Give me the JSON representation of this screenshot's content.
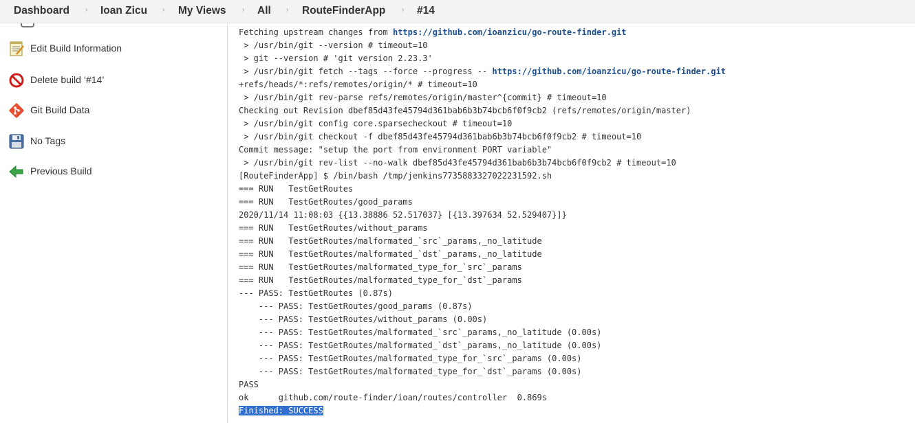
{
  "breadcrumb": {
    "items": [
      "Dashboard",
      "Ioan Zicu",
      "My Views",
      "All",
      "RouteFinderApp",
      "#14"
    ],
    "separator": "›"
  },
  "sidebar": {
    "items": [
      {
        "label": "Edit Build Information",
        "icon": "notepad-icon"
      },
      {
        "label": "Delete build ‘#14’",
        "icon": "no-entry-icon"
      },
      {
        "label": "Git Build Data",
        "icon": "git-icon"
      },
      {
        "label": "No Tags",
        "icon": "floppy-disk-icon"
      },
      {
        "label": "Previous Build",
        "icon": "left-arrow-icon"
      }
    ]
  },
  "console": {
    "lines": [
      {
        "pre": "Fetching upstream changes from ",
        "link": "https://github.com/ioanzicu/go-route-finder.git",
        "post": ""
      },
      {
        "text": " > /usr/bin/git --version # timeout=10"
      },
      {
        "text": " > git --version # 'git version 2.23.3'"
      },
      {
        "pre": " > /usr/bin/git fetch --tags --force --progress -- ",
        "link": "https://github.com/ioanzicu/go-route-finder.git",
        "post": ""
      },
      {
        "text": "+refs/heads/*:refs/remotes/origin/* # timeout=10"
      },
      {
        "text": " > /usr/bin/git rev-parse refs/remotes/origin/master^{commit} # timeout=10"
      },
      {
        "text": "Checking out Revision dbef85d43fe45794d361bab6b3b74bcb6f0f9cb2 (refs/remotes/origin/master)"
      },
      {
        "text": " > /usr/bin/git config core.sparsecheckout # timeout=10"
      },
      {
        "text": " > /usr/bin/git checkout -f dbef85d43fe45794d361bab6b3b74bcb6f0f9cb2 # timeout=10"
      },
      {
        "text": "Commit message: \"setup the port from environment PORT variable\""
      },
      {
        "text": " > /usr/bin/git rev-list --no-walk dbef85d43fe45794d361bab6b3b74bcb6f0f9cb2 # timeout=10"
      },
      {
        "text": "[RouteFinderApp] $ /bin/bash /tmp/jenkins7735883327022231592.sh"
      },
      {
        "text": "=== RUN   TestGetRoutes"
      },
      {
        "text": "=== RUN   TestGetRoutes/good_params"
      },
      {
        "text": "2020/11/14 11:08:03 {{13.38886 52.517037} [{13.397634 52.529407}]}"
      },
      {
        "text": "=== RUN   TestGetRoutes/without_params"
      },
      {
        "text": "=== RUN   TestGetRoutes/malformated_`src`_params,_no_latitude"
      },
      {
        "text": "=== RUN   TestGetRoutes/malformated_`dst`_params,_no_latitude"
      },
      {
        "text": "=== RUN   TestGetRoutes/malformated_type_for_`src`_params"
      },
      {
        "text": "=== RUN   TestGetRoutes/malformated_type_for_`dst`_params"
      },
      {
        "text": "--- PASS: TestGetRoutes (0.87s)"
      },
      {
        "text": "    --- PASS: TestGetRoutes/good_params (0.87s)"
      },
      {
        "text": "    --- PASS: TestGetRoutes/without_params (0.00s)"
      },
      {
        "text": "    --- PASS: TestGetRoutes/malformated_`src`_params,_no_latitude (0.00s)"
      },
      {
        "text": "    --- PASS: TestGetRoutes/malformated_`dst`_params,_no_latitude (0.00s)"
      },
      {
        "text": "    --- PASS: TestGetRoutes/malformated_type_for_`src`_params (0.00s)"
      },
      {
        "text": "    --- PASS: TestGetRoutes/malformated_type_for_`dst`_params (0.00s)"
      },
      {
        "text": "PASS"
      },
      {
        "text": "ok  \tgithub.com/route-finder/ioan/routes/controller  0.869s"
      },
      {
        "text": "Finished: SUCCESS",
        "highlight": true
      }
    ]
  },
  "colors": {
    "link": "#1c4e8d",
    "selection": "#3270d0",
    "breadcrumb_bg": "#f3f3f3"
  }
}
